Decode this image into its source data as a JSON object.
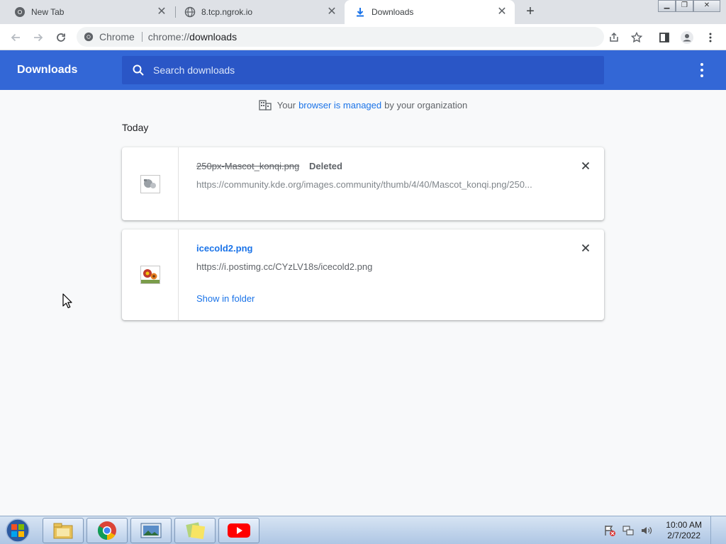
{
  "tabs": [
    {
      "title": "New Tab",
      "icon": "chrome-logo-icon"
    },
    {
      "title": "8.tcp.ngrok.io",
      "icon": "globe-icon"
    },
    {
      "title": "Downloads",
      "icon": "download-icon",
      "active": true
    }
  ],
  "omnibox": {
    "site": "Chrome",
    "url_prefix": "chrome://",
    "url_path": "downloads"
  },
  "downloads_page": {
    "title": "Downloads",
    "search_placeholder": "Search downloads",
    "managed_prefix": "Your",
    "managed_link": "browser is managed",
    "managed_suffix": "by your organization",
    "section_label": "Today",
    "items": [
      {
        "filename": "250px-Mascot_konqi.png",
        "status": "Deleted",
        "url": "https://community.kde.org/images.community/thumb/4/40/Mascot_konqi.png/250...",
        "deleted": true
      },
      {
        "filename": "icecold2.png",
        "url": "https://i.postimg.cc/CYzLV18s/icecold2.png",
        "action": "Show in folder",
        "deleted": false
      }
    ]
  },
  "taskbar": {
    "items": [
      "file-explorer-icon",
      "chrome-icon",
      "image-viewer-icon",
      "sticky-notes-icon",
      "youtube-icon"
    ],
    "clock": {
      "time": "10:00 AM",
      "date": "2/7/2022"
    }
  },
  "colors": {
    "accent": "#3367d6",
    "link": "#1a73e8"
  }
}
